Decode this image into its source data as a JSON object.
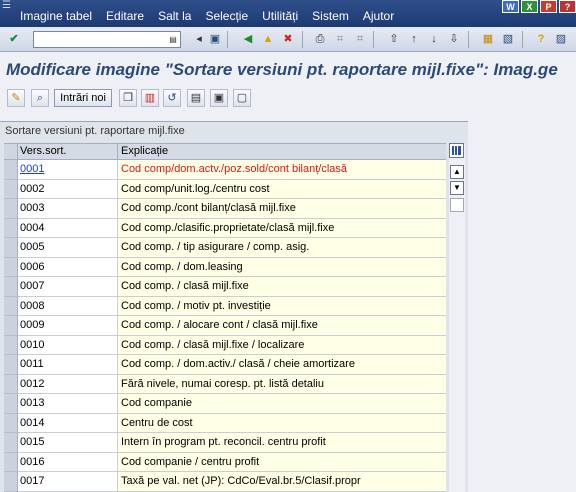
{
  "menu": {
    "items": [
      "Imagine tabel",
      "Editare",
      "Salt la",
      "Selecție",
      "Utilități",
      "Sistem",
      "Ajutor"
    ],
    "office_icons": [
      "W",
      "X",
      "P",
      "?"
    ]
  },
  "toolbar": {
    "command_value": "",
    "icons": [
      "enter-icon",
      "save-icon",
      "back-icon",
      "exit-icon",
      "cancel-icon",
      "print-icon",
      "find-icon",
      "find-next-icon",
      "first-page-icon",
      "prev-page-icon",
      "next-page-icon",
      "last-page-icon",
      "create-session-icon",
      "shortcut-icon",
      "help-icon",
      "customize-layout-icon"
    ]
  },
  "title": "Modificare imagine \"Sortare versiuni pt. raportare mijl.fixe\": Imag.ge",
  "app_toolbar": {
    "new_entries_label": "Intrări noi"
  },
  "table": {
    "caption": "Sortare versiuni pt. raportare mijl.fixe",
    "headers": [
      "Vers.sort.",
      "Explicație"
    ],
    "rows": [
      {
        "code": "0001",
        "text": "Cod comp/dom.actv./poz.sold/cont bilanț/clasă"
      },
      {
        "code": "0002",
        "text": "Cod comp/unit.log./centru cost"
      },
      {
        "code": "0003",
        "text": "Cod comp./cont bilanț/clasă mijl.fixe"
      },
      {
        "code": "0004",
        "text": "Cod comp./clasific.proprietate/clasă mijl.fixe"
      },
      {
        "code": "0005",
        "text": "Cod comp. / tip asigurare / comp. asig."
      },
      {
        "code": "0006",
        "text": "Cod comp. / dom.leasing"
      },
      {
        "code": "0007",
        "text": "Cod comp. / clasă mijl.fixe"
      },
      {
        "code": "0008",
        "text": "Cod comp. / motiv pt. investiție"
      },
      {
        "code": "0009",
        "text": "Cod comp. / alocare cont / clasă mijl.fixe"
      },
      {
        "code": "0010",
        "text": "Cod comp. / clasă mijl.fixe / localizare"
      },
      {
        "code": "0011",
        "text": "Cod comp. / dom.activ./ clasă / cheie amortizare"
      },
      {
        "code": "0012",
        "text": "Fără nivele, numai coresp. pt. listă detaliu"
      },
      {
        "code": "0013",
        "text": "Cod companie"
      },
      {
        "code": "0014",
        "text": "Centru de cost"
      },
      {
        "code": "0015",
        "text": "Intern în program pt. reconcil. centru profit"
      },
      {
        "code": "0016",
        "text": "Cod companie / centru profit"
      },
      {
        "code": "0017",
        "text": "Taxă pe val. net (JP): CdCo/Eval.br.5/Clasif.propr"
      }
    ]
  },
  "colors": {
    "menubar": "#1d3a72",
    "title_text": "#2b4a7b",
    "active_row_text": "#d81818",
    "active_code_text": "#1a3cc7",
    "description_bg": "#ffffe6"
  }
}
